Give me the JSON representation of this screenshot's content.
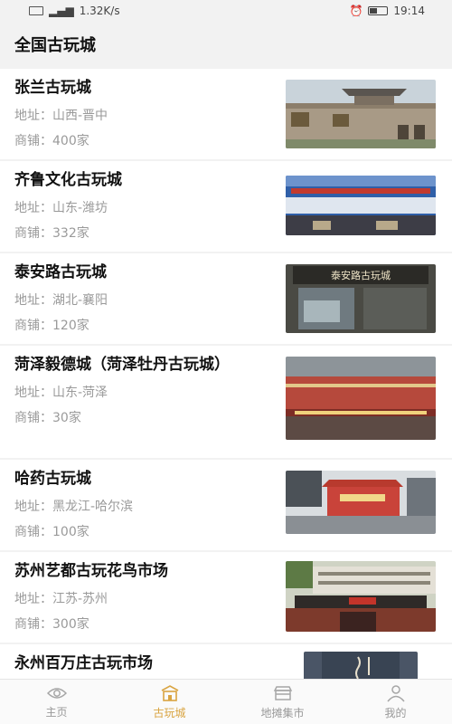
{
  "status": {
    "speed": "1.32K/s",
    "time": "19:14",
    "colors": {
      "accent": "#d9a441"
    }
  },
  "header": {
    "title": "全国古玩城"
  },
  "address_label": "地址：",
  "shops_label": "商铺：",
  "markets": [
    {
      "name": "张兰古玩城",
      "address": "山西-晋中",
      "shops": "400家"
    },
    {
      "name": "齐鲁文化古玩城",
      "address": "山东-潍坊",
      "shops": "332家"
    },
    {
      "name": "泰安路古玩城",
      "address": "湖北-襄阳",
      "shops": "120家",
      "sign": "泰安路古玩城"
    },
    {
      "name": "菏泽毅德城（菏泽牡丹古玩城）",
      "address": "山东-菏泽",
      "shops": "30家"
    },
    {
      "name": "哈药古玩城",
      "address": "黑龙江-哈尔滨",
      "shops": "100家"
    },
    {
      "name": "苏州艺都古玩花鸟市场",
      "address": "江苏-苏州",
      "shops": "300家"
    },
    {
      "name": "永州百万庄古玩市场"
    }
  ],
  "tabs": [
    {
      "label": "主页",
      "icon": "eye-icon"
    },
    {
      "label": "古玩城",
      "icon": "palace-icon"
    },
    {
      "label": "地摊集市",
      "icon": "stall-icon"
    },
    {
      "label": "我的",
      "icon": "user-icon"
    }
  ]
}
